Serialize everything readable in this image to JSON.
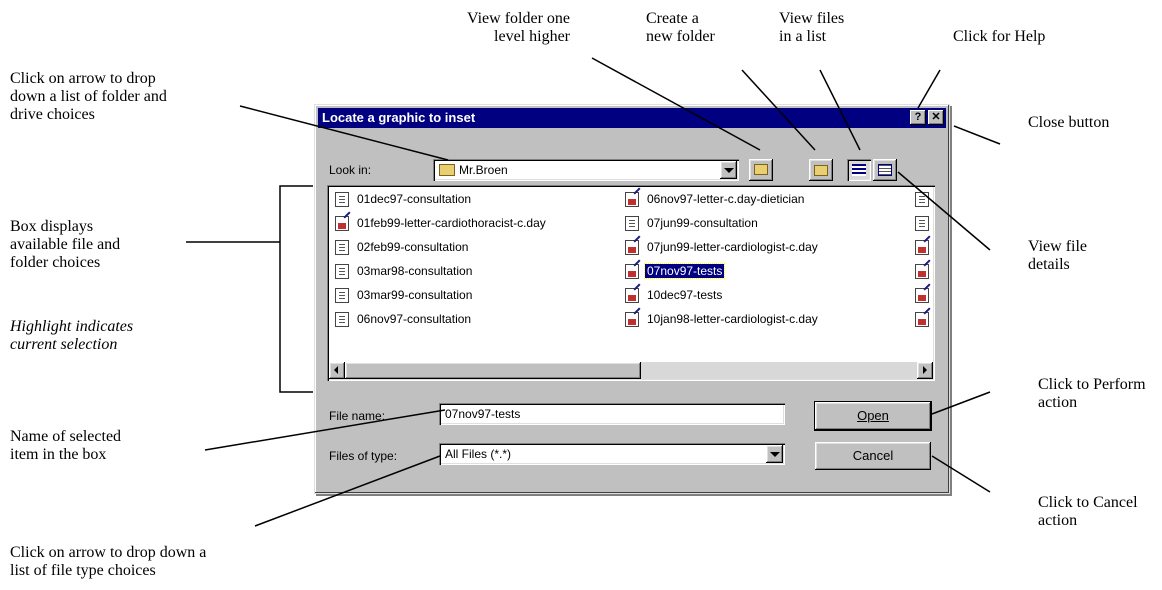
{
  "annotations": {
    "up_folder": [
      "View folder one",
      "level higher"
    ],
    "new_folder": [
      "Create  a",
      "new folder"
    ],
    "list_view": [
      "View files",
      "in a list"
    ],
    "help": "Click for Help",
    "look_in": [
      "Click on arrow to drop",
      "down a list of folder and",
      "drive choices"
    ],
    "close": "Close button",
    "file_box": [
      "Box displays",
      "available file and",
      "folder choices"
    ],
    "highlight": [
      "Highlight indicates",
      "current selection"
    ],
    "details": [
      "View file",
      "details"
    ],
    "perform": [
      "Click to Perform",
      "action"
    ],
    "name": [
      "Name of selected",
      "item in the box"
    ],
    "cancel": [
      "Click to Cancel",
      "action"
    ],
    "filetype": [
      "Click on arrow to drop down a",
      "list of file type choices"
    ]
  },
  "dialog": {
    "title": "Locate a graphic to inset",
    "help_glyph": "?",
    "close_glyph": "✕",
    "look_in_label": "Look in:",
    "look_in_value": "Mr.Broen",
    "file_name_label": "File name:",
    "file_name_value": "07nov97-tests",
    "files_of_type_label": "Files of type:",
    "files_of_type_value": "All Files (*.*)",
    "open_label": "Open",
    "cancel_label": "Cancel",
    "files_col1": [
      {
        "name": "01dec97-consultation",
        "icon": "text-document-icon"
      },
      {
        "name": "01feb99-letter-cardiothoracist-c.day",
        "icon": "word-document-icon"
      },
      {
        "name": "02feb99-consultation",
        "icon": "text-document-icon"
      },
      {
        "name": "03mar98-consultation",
        "icon": "text-document-icon"
      },
      {
        "name": "03mar99-consultation",
        "icon": "text-document-icon"
      },
      {
        "name": "06nov97-consultation",
        "icon": "text-document-icon"
      }
    ],
    "files_col2": [
      {
        "name": "06nov97-letter-c.day-dietician",
        "icon": "word-document-icon"
      },
      {
        "name": "07jun99-consultation",
        "icon": "text-document-icon"
      },
      {
        "name": "07jun99-letter-cardiologist-c.day",
        "icon": "word-document-icon"
      },
      {
        "name": "07nov97-tests",
        "icon": "word-document-icon",
        "selected": true
      },
      {
        "name": "10dec97-tests",
        "icon": "word-document-icon"
      },
      {
        "name": "10jan98-letter-cardiologist-c.day",
        "icon": "word-document-icon"
      }
    ],
    "files_col3_icons": [
      "text-document-icon",
      "text-document-icon",
      "word-document-icon",
      "word-document-icon",
      "word-document-icon",
      "word-document-icon"
    ]
  }
}
